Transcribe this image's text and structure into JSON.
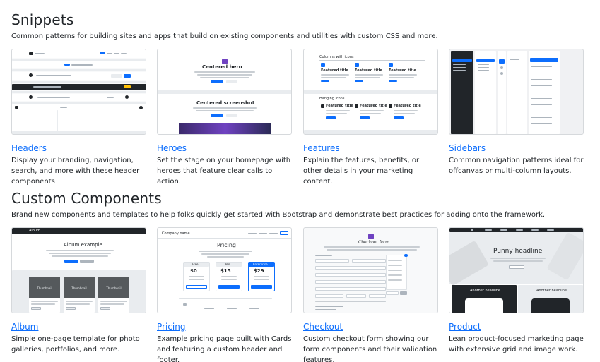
{
  "snippets": {
    "title": "Snippets",
    "description": "Common patterns for building sites and apps that build on existing components and utilities with custom CSS and more.",
    "cards": [
      {
        "title": "Headers",
        "description": "Display your branding, navigation, search, and more with these header components"
      },
      {
        "title": "Heroes",
        "description": "Set the stage on your homepage with heroes that feature clear calls to action."
      },
      {
        "title": "Features",
        "description": "Explain the features, benefits, or other details in your marketing content."
      },
      {
        "title": "Sidebars",
        "description": "Common navigation patterns ideal for offcanvas or multi-column layouts."
      }
    ]
  },
  "custom": {
    "title": "Custom Components",
    "description": "Brand new components and templates to help folks quickly get started with Bootstrap and demonstrate best practices for adding onto the framework.",
    "cards": [
      {
        "title": "Album",
        "description": "Simple one-page template for photo galleries, portfolios, and more."
      },
      {
        "title": "Pricing",
        "description": "Example pricing page built with Cards and featuring a custom header and footer."
      },
      {
        "title": "Checkout",
        "description": "Custom checkout form showing our form components and their validation features."
      },
      {
        "title": "Product",
        "description": "Lean product-focused marketing page with extensive grid and image work."
      }
    ]
  },
  "thumbs": {
    "heroes_text1": "Centered hero",
    "heroes_text2": "Centered screenshot",
    "features_text1": "Columns with icons",
    "features_text2": "Hanging icons",
    "features_item": "Featured title",
    "album_title": "Album example",
    "album_brand": "Album",
    "album_thumb": "Thumbnail",
    "pricing_title": "Pricing",
    "pricing_brand": "Company name",
    "pricing_tiers": [
      "Free",
      "Pro",
      "Enterprise"
    ],
    "pricing_prices": [
      "$0",
      "$15",
      "$29"
    ],
    "checkout_title": "Checkout form",
    "product_title": "Punny headline",
    "product_sub": "Another headline"
  }
}
